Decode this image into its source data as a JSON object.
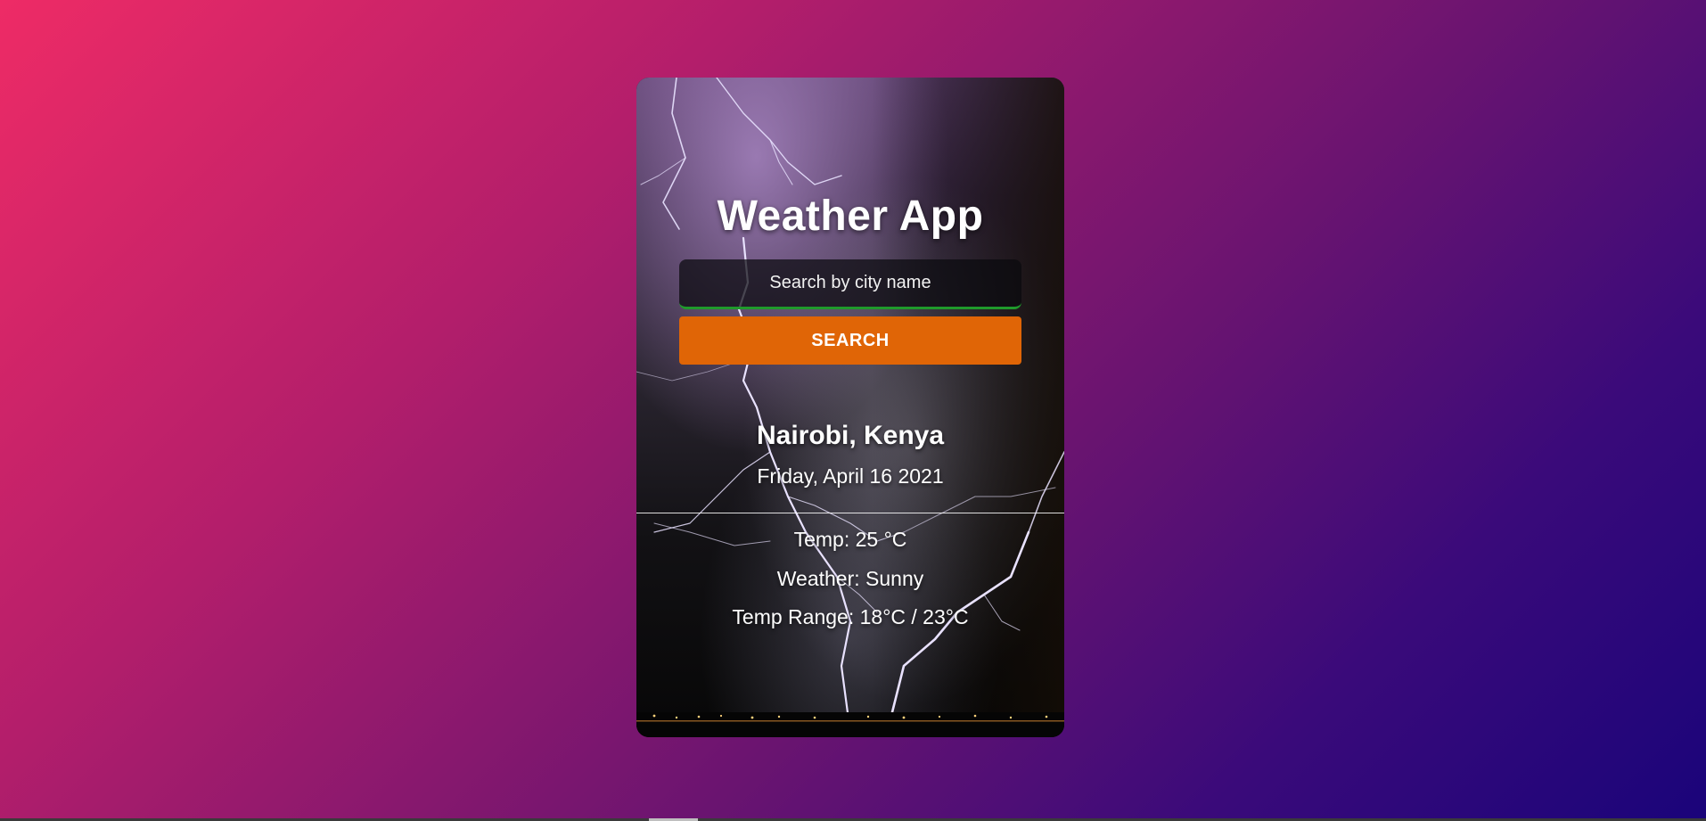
{
  "app": {
    "title": "Weather App"
  },
  "search": {
    "placeholder": "Search by city name",
    "value": "",
    "button_label": "SEARCH"
  },
  "result": {
    "location": "Nairobi, Kenya",
    "date": "Friday, April 16 2021",
    "temp": "Temp: 25 °C",
    "weather": "Weather: Sunny",
    "temp_range": "Temp Range: 18°C / 23°C"
  },
  "colors": {
    "background_top_left": "#ee2b66",
    "background_bottom_right": "#1a047a",
    "button": "#e06506",
    "input_accent": "#1f9a2b"
  }
}
